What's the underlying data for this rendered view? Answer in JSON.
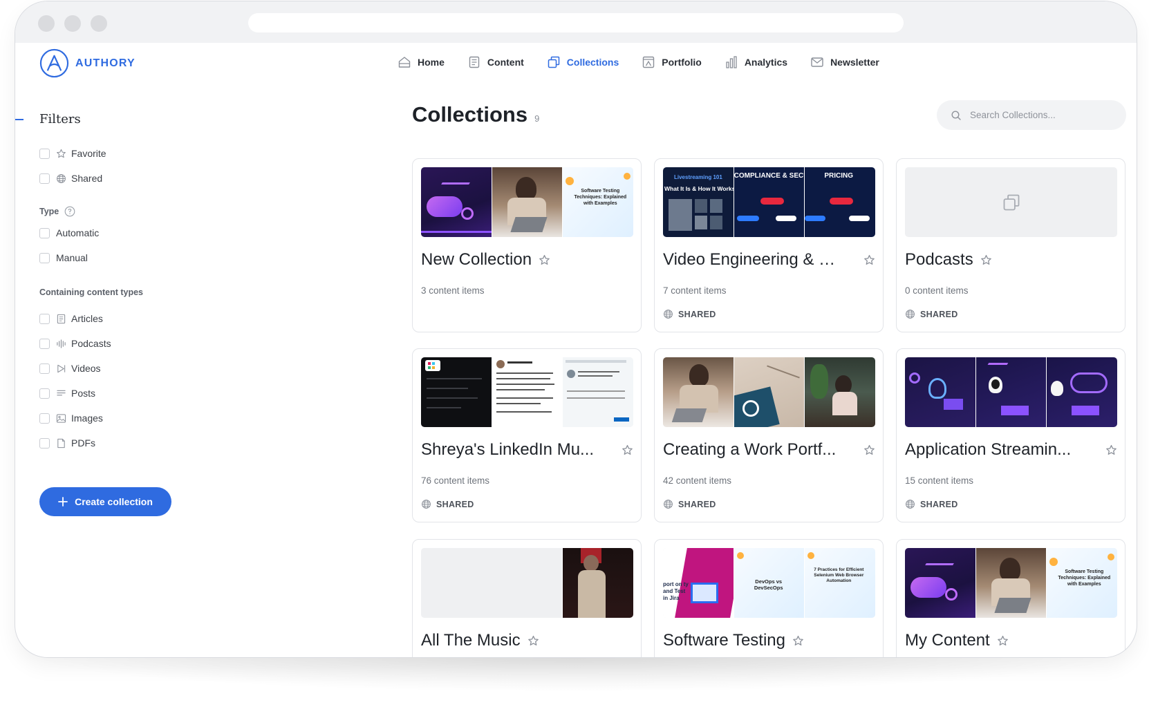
{
  "brand": {
    "name": "AUTHORY",
    "color": "#2f6be0"
  },
  "nav": [
    {
      "label": "Home",
      "icon": "home-icon",
      "active": false
    },
    {
      "label": "Content",
      "icon": "content-icon",
      "active": false
    },
    {
      "label": "Collections",
      "icon": "collections-icon",
      "active": true
    },
    {
      "label": "Portfolio",
      "icon": "portfolio-icon",
      "active": false
    },
    {
      "label": "Analytics",
      "icon": "analytics-icon",
      "active": false
    },
    {
      "label": "Newsletter",
      "icon": "newsletter-icon",
      "active": false
    }
  ],
  "filters": {
    "title": "Filters",
    "general": [
      {
        "label": "Favorite",
        "icon": "star-icon"
      },
      {
        "label": "Shared",
        "icon": "globe-icon"
      }
    ],
    "type_label": "Type",
    "types": [
      {
        "label": "Automatic"
      },
      {
        "label": "Manual"
      }
    ],
    "content_types_label": "Containing content types",
    "content_types": [
      {
        "label": "Articles",
        "icon": "article-icon"
      },
      {
        "label": "Podcasts",
        "icon": "podcast-icon"
      },
      {
        "label": "Videos",
        "icon": "video-icon"
      },
      {
        "label": "Posts",
        "icon": "post-icon"
      },
      {
        "label": "Images",
        "icon": "image-icon"
      },
      {
        "label": "PDFs",
        "icon": "pdf-icon"
      }
    ],
    "create_button": "Create collection"
  },
  "main": {
    "title": "Collections",
    "count": "9",
    "search_placeholder": "Search Collections...",
    "collections": [
      {
        "title": "New Collection",
        "count": "3 content items",
        "shared": ""
      },
      {
        "title": "Video Engineering & S...",
        "count": "7 content items",
        "shared": "SHARED"
      },
      {
        "title": "Podcasts",
        "count": "0 content items",
        "shared": "SHARED"
      },
      {
        "title": "Shreya's LinkedIn Mu...",
        "count": "76 content items",
        "shared": "SHARED"
      },
      {
        "title": "Creating a Work Portf...",
        "count": "42 content items",
        "shared": "SHARED"
      },
      {
        "title": "Application Streamin...",
        "count": "15 content items",
        "shared": "SHARED"
      },
      {
        "title": "All The Music",
        "count": "",
        "shared": ""
      },
      {
        "title": "Software Testing",
        "count": "",
        "shared": ""
      },
      {
        "title": "My Content",
        "count": "",
        "shared": ""
      }
    ],
    "thumb_text": {
      "livestreaming": "Livestreaming 101",
      "what_it_is": "What It Is & How It Works",
      "compliance": "COMPLIANCE & SECUR",
      "pricing": "PRICING",
      "software_testing": "Software Testing Techniques: Explained with Examples",
      "devops": "DevOps vs DevSecOps",
      "selenium": "7 Practices for Efficient Selenium Web Browser Automation",
      "jira": "port on ty and Test in Jira"
    }
  }
}
